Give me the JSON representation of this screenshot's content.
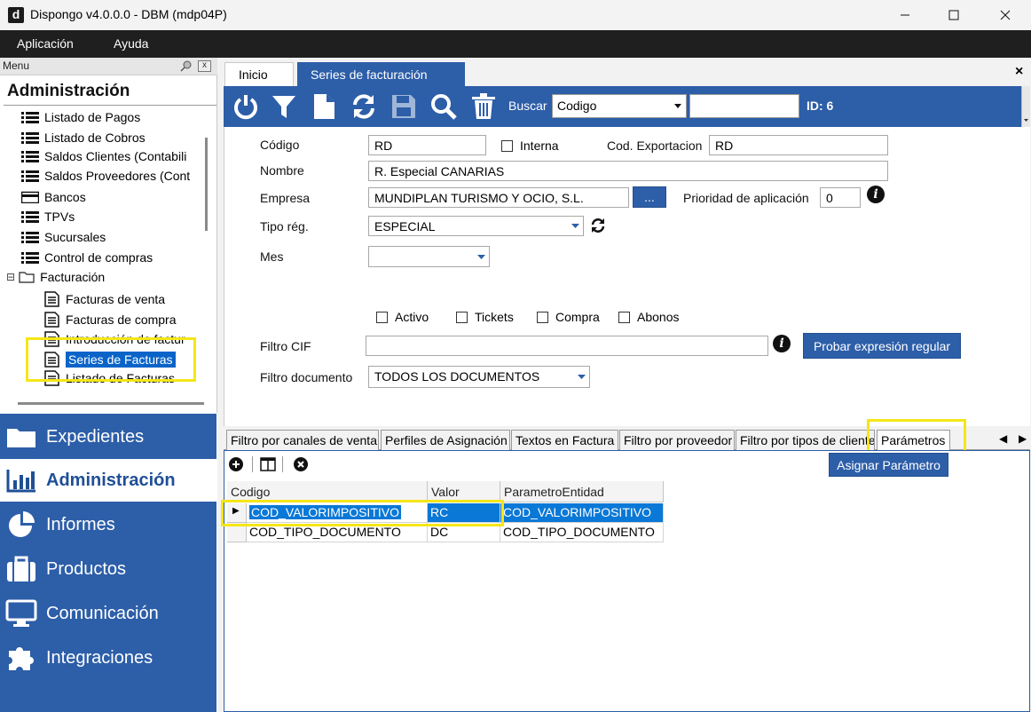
{
  "window": {
    "logo_letter": "d",
    "title": "Dispongo v4.0.0.0 - DBM (mdp04P)",
    "minimize": "—",
    "maximize": "☐",
    "close": "✕"
  },
  "menubar": {
    "items": [
      "Aplicación",
      "Ayuda"
    ]
  },
  "left_panel": {
    "caption": "Menu",
    "close_glyph": "x",
    "header": "Administración",
    "tree": [
      "Listado de Pagos",
      "Listado de Cobros",
      "Saldos Clientes (Contabili",
      "Saldos Proveedores (Cont",
      "Bancos",
      "TPVs",
      "Sucursales",
      "Control de compras",
      "Facturación",
      "Facturas de venta",
      "Facturas de compra",
      "Introducción de factur",
      "Series de Facturas",
      "Listado de Facturas"
    ],
    "expand_glyph": "⊟"
  },
  "nav": {
    "items": [
      "Expedientes",
      "Administración",
      "Informes",
      "Productos",
      "Comunicación",
      "Integraciones"
    ],
    "active": "Administración"
  },
  "doc_tabs": {
    "inicio": "Inicio",
    "series": "Series de facturación",
    "close": "×"
  },
  "toolbar": {
    "buscar_label": "Buscar",
    "buscar_value": "Codigo",
    "id_label": "ID: 6",
    "icons": [
      "power-icon",
      "filter-icon",
      "new-document-icon",
      "refresh-icon",
      "save-icon",
      "search-icon",
      "delete-icon"
    ]
  },
  "form": {
    "codigo_label": "Código",
    "codigo_value": "RD",
    "interna_label": "Interna",
    "cod_export_label": "Cod. Exportacion",
    "cod_export_value": "RD",
    "nombre_label": "Nombre",
    "nombre_value": "R. Especial CANARIAS",
    "empresa_label": "Empresa",
    "empresa_value": "MUNDIPLAN TURISMO Y OCIO, S.L.",
    "empresa_btn": "...",
    "prioridad_label": "Prioridad de aplicación",
    "prioridad_value": "0",
    "tipo_reg_label": "Tipo rég.",
    "tipo_reg_value": "ESPECIAL",
    "mes_label": "Mes",
    "mes_value": "",
    "activo_label": "Activo",
    "tickets_label": "Tickets",
    "compra_label": "Compra",
    "abonos_label": "Abonos",
    "filtro_cif_label": "Filtro CIF",
    "filtro_cif_value": "",
    "probar_btn": "Probar expresión regular",
    "filtro_doc_label": "Filtro documento",
    "filtro_doc_value": "TODOS LOS DOCUMENTOS",
    "info_glyph": "i"
  },
  "bottom_tabs": {
    "items": [
      "Filtro por canales de venta",
      "Perfiles de Asignación",
      "Textos en Factura",
      "Filtro por proveedor",
      "Filtro por tipos de cliente",
      "Parámetros"
    ],
    "active": "Parámetros",
    "prev": "◀",
    "next": "▶"
  },
  "grid": {
    "asignar_btn": "Asignar Parámetro",
    "columns": [
      "Codigo",
      "Valor",
      "ParametroEntidad"
    ],
    "rows": [
      [
        "COD_VALORIMPOSITIVO",
        "RC",
        "COD_VALORIMPOSITIVO"
      ],
      [
        "COD_TIPO_DOCUMENTO",
        "DC",
        "COD_TIPO_DOCUMENTO"
      ]
    ],
    "current_row_marker": "▶"
  },
  "colors": {
    "brand_blue": "#2d5ea8",
    "selection_blue": "#0a78d7",
    "highlight_yellow": "#f5e617"
  }
}
